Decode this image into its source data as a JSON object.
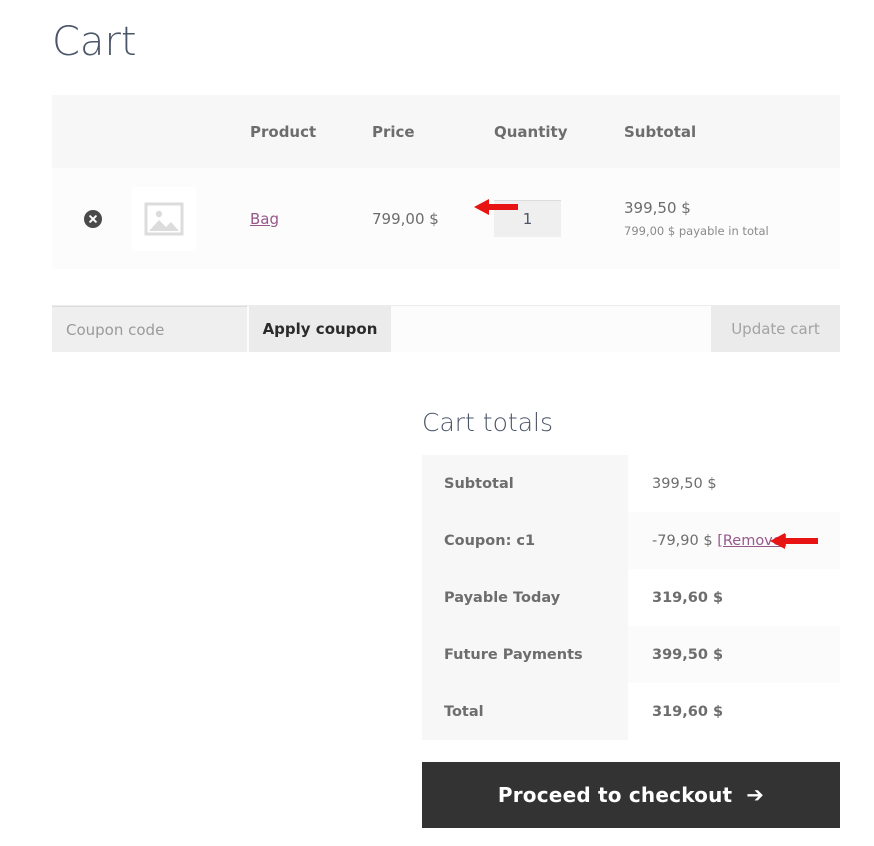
{
  "page": {
    "title": "Cart"
  },
  "cart_table": {
    "headers": {
      "remove": "",
      "thumbnail": "",
      "product": "Product",
      "price": "Price",
      "quantity": "Quantity",
      "subtotal": "Subtotal"
    },
    "rows": [
      {
        "remove_icon": "remove-circle-x-icon",
        "thumbnail_icon": "image-placeholder-icon",
        "product_name": "Bag",
        "price": "799,00 $",
        "quantity": "1",
        "subtotal": "399,50 $",
        "subtotal_note": "799,00 $ payable in total"
      }
    ]
  },
  "coupon": {
    "placeholder": "Coupon code",
    "value": "",
    "apply_label": "Apply coupon",
    "update_label": "Update cart"
  },
  "totals": {
    "title": "Cart totals",
    "rows": [
      {
        "label": "Subtotal",
        "value": "399,50 $",
        "bold": false,
        "link": null
      },
      {
        "label": "Coupon: c1",
        "value": "-79,90 $",
        "bold": false,
        "link": "[Remove]"
      },
      {
        "label": "Payable Today",
        "value": "319,60 $",
        "bold": true,
        "link": null
      },
      {
        "label": "Future Payments",
        "value": "399,50 $",
        "bold": true,
        "link": null
      },
      {
        "label": "Total",
        "value": "319,60 $",
        "bold": true,
        "link": null
      }
    ]
  },
  "checkout": {
    "label": "Proceed to checkout",
    "arrow": "➔"
  },
  "annotations": [
    {
      "name": "price-arrow",
      "direction": "left",
      "color": "#e81313"
    },
    {
      "name": "remove-arrow",
      "direction": "left",
      "color": "#e81313"
    }
  ],
  "colors": {
    "link": "#96588a",
    "checkout_bg": "#333333",
    "header_bg": "#f7f7f7",
    "annotation_red": "#e81313"
  }
}
